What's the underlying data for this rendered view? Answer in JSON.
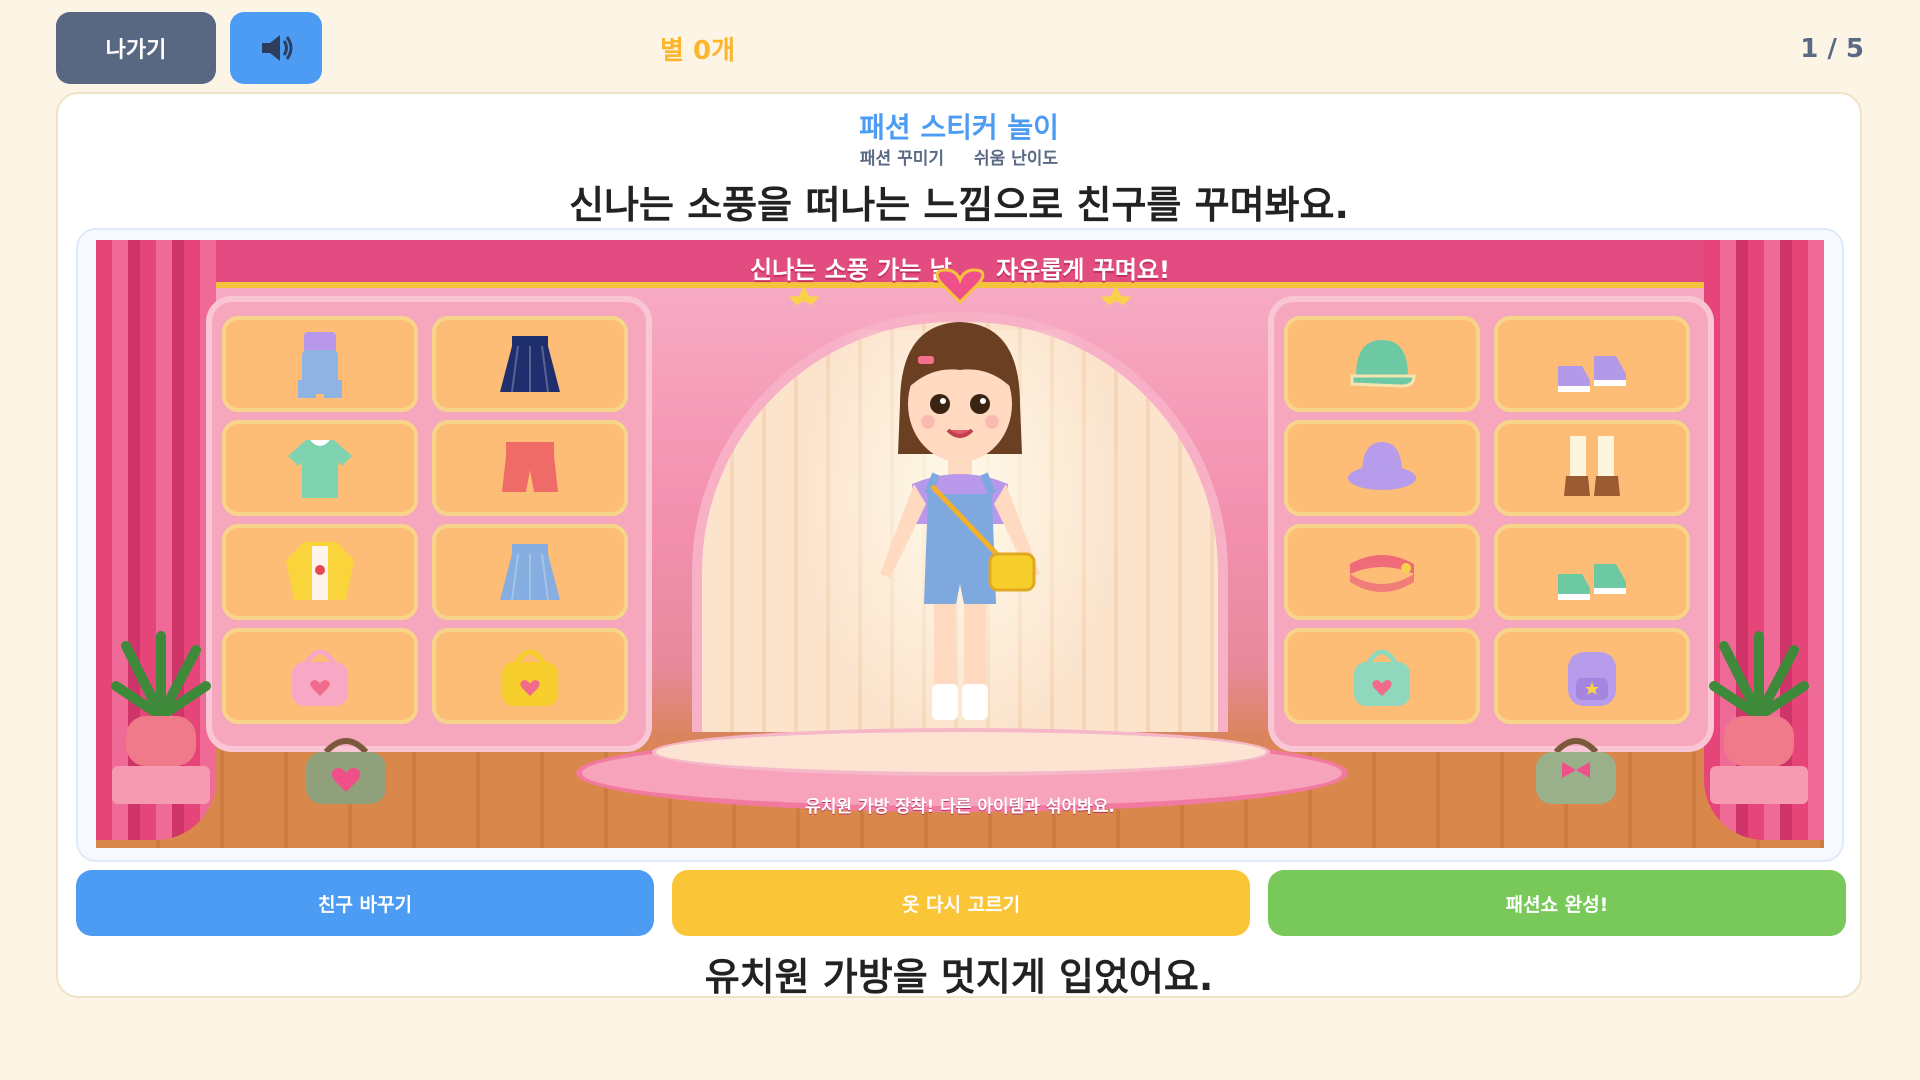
{
  "header": {
    "exit_label": "나가기",
    "sound_icon": "speaker-icon",
    "stars_label": "별 0개",
    "progress_label": "1 / 5"
  },
  "game": {
    "title": "패션 스티커 놀이",
    "category": "패션 꾸미기",
    "difficulty": "쉬움 난이도",
    "instruction": "신나는 소풍을 떠나는 느낌으로 친구를 꾸며봐요."
  },
  "stage": {
    "banner_left": "신나는 소풍 가는 날",
    "banner_right": "자유롭게 꾸며요!",
    "caption": "유치원 가방 장착! 다른 아이템과 섞어봐요."
  },
  "wardrobe_left": [
    {
      "name": "overalls",
      "icon": "overalls-icon",
      "color": "#8fb4e3"
    },
    {
      "name": "pleated-skirt-navy",
      "icon": "skirt-icon",
      "color": "#1f2f6e"
    },
    {
      "name": "collar-shirt-mint",
      "icon": "shirt-icon",
      "color": "#7fd3b0"
    },
    {
      "name": "shorts-coral",
      "icon": "shorts-icon",
      "color": "#ef6b68"
    },
    {
      "name": "cardigan-yellow",
      "icon": "cardigan-icon",
      "color": "#f9d43a"
    },
    {
      "name": "denim-skirt",
      "icon": "skirt-icon",
      "color": "#87aee0"
    },
    {
      "name": "heart-bag-pink",
      "icon": "bag-icon",
      "color": "#f7a8c4"
    },
    {
      "name": "kindergarten-bag-yellow",
      "icon": "bag-icon",
      "color": "#f7cf2c"
    }
  ],
  "wardrobe_right": [
    {
      "name": "cap-mint",
      "icon": "cap-icon",
      "color": "#6cc9a4"
    },
    {
      "name": "sneakers-purple",
      "icon": "sneakers-icon",
      "color": "#b29ae8"
    },
    {
      "name": "bucket-hat-purple",
      "icon": "hat-icon",
      "color": "#b79cec"
    },
    {
      "name": "mary-jane-brown",
      "icon": "shoes-icon",
      "color": "#9a5a32"
    },
    {
      "name": "visor-coral",
      "icon": "visor-icon",
      "color": "#ef6b7a"
    },
    {
      "name": "sneakers-mint",
      "icon": "sneakers-icon",
      "color": "#6cc9a4"
    },
    {
      "name": "strawberry-bag-mint",
      "icon": "bag-icon",
      "color": "#8fd8bd"
    },
    {
      "name": "backpack-purple",
      "icon": "backpack-icon",
      "color": "#b79cec"
    }
  ],
  "actions": {
    "change_friend": "친구 바꾸기",
    "reselect_clothes": "옷 다시 고르기",
    "finish_show": "패션쇼 완성!"
  },
  "feedback": "유치원 가방을 멋지게 입었어요.",
  "colors": {
    "background": "#fcf5e6",
    "exit_button": "#586782",
    "accent_blue": "#4b9cf2",
    "accent_yellow": "#fbc538",
    "accent_green": "#78c95a",
    "stars_text": "#fbb62e"
  }
}
